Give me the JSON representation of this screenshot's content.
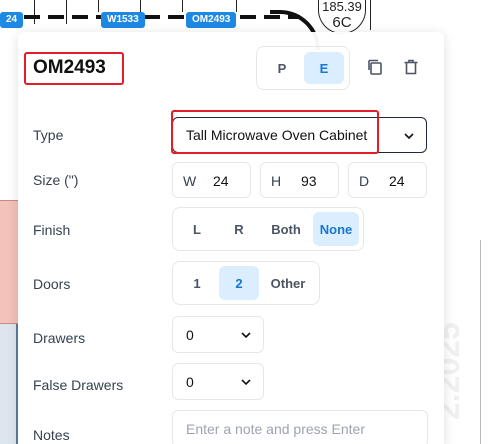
{
  "canvas": {
    "tags": [
      "24",
      "W1533",
      "OM2493"
    ],
    "symbol_top": "185.39",
    "symbol_bottom": "6C",
    "watermark": "2.2025"
  },
  "panel": {
    "title": "OM2493",
    "mode_buttons": [
      "P",
      "E"
    ],
    "active_mode": "E",
    "copy_icon": "copy-icon",
    "delete_icon": "trash-icon",
    "type": {
      "label": "Type",
      "value": "Tall Microwave Oven Cabinet"
    },
    "size": {
      "label": "Size (\")",
      "width_label": "W",
      "width_value": "24",
      "height_label": "H",
      "height_value": "93",
      "depth_label": "D",
      "depth_value": "24"
    },
    "finish": {
      "label": "Finish",
      "options": [
        "L",
        "R",
        "Both",
        "None"
      ],
      "selected": "None"
    },
    "doors": {
      "label": "Doors",
      "options": [
        "1",
        "2",
        "Other"
      ],
      "selected": "2"
    },
    "drawers": {
      "label": "Drawers",
      "value": "0"
    },
    "false_drawers": {
      "label": "False Drawers",
      "value": "0"
    },
    "notes": {
      "label": "Notes",
      "placeholder": "Enter a note and press Enter"
    }
  },
  "colors": {
    "accent": "#1976d2",
    "accent_bg": "#dbeeff",
    "highlight": "#e11d2a",
    "tag_blue": "#1e88e5"
  }
}
